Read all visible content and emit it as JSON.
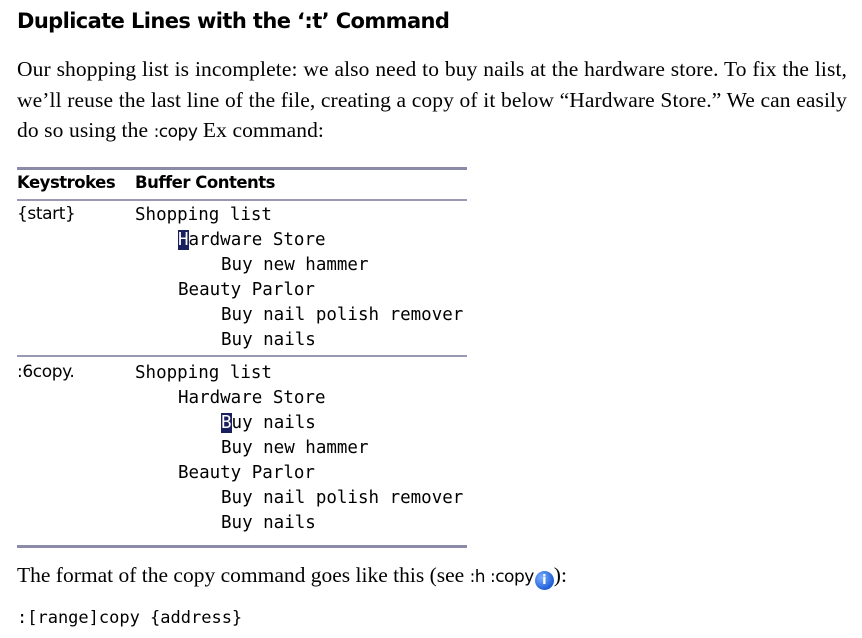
{
  "heading": "Duplicate Lines with the ‘:t’ Command",
  "paragraph": {
    "before": "Our shopping list is incomplete: we also need to buy nails at the hardware store. To fix the list, we’ll reuse the last line of the file, creating a copy of it below “Hardware Store.” We can easily do so using the ",
    "command": ":copy",
    "after": " Ex command:"
  },
  "table": {
    "headers": [
      "Keystrokes",
      "Buffer Contents"
    ],
    "rows": [
      {
        "keystroke": "{start}",
        "lines": [
          {
            "indent": 0,
            "cursor": "",
            "text": "Shopping list"
          },
          {
            "indent": 1,
            "cursor": "H",
            "text": "ardware Store"
          },
          {
            "indent": 2,
            "cursor": "",
            "text": "Buy new hammer"
          },
          {
            "indent": 1,
            "cursor": "",
            "text": "Beauty Parlor"
          },
          {
            "indent": 2,
            "cursor": "",
            "text": "Buy nail polish remover"
          },
          {
            "indent": 2,
            "cursor": "",
            "text": "Buy nails"
          }
        ]
      },
      {
        "keystroke": ":6copy.",
        "lines": [
          {
            "indent": 0,
            "cursor": "",
            "text": "Shopping list"
          },
          {
            "indent": 1,
            "cursor": "",
            "text": "Hardware Store"
          },
          {
            "indent": 2,
            "cursor": "B",
            "text": "uy nails"
          },
          {
            "indent": 2,
            "cursor": "",
            "text": "Buy new hammer"
          },
          {
            "indent": 1,
            "cursor": "",
            "text": "Beauty Parlor"
          },
          {
            "indent": 2,
            "cursor": "",
            "text": "Buy nail polish remover"
          },
          {
            "indent": 2,
            "cursor": "",
            "text": "Buy nails"
          }
        ]
      }
    ]
  },
  "footer": {
    "before": "The format of the copy command goes like this (see ",
    "help_ref": ":h :copy",
    "icon": "info-icon",
    "icon_glyph": "i",
    "after": "):"
  },
  "syntax": ":[range]copy {address}"
}
